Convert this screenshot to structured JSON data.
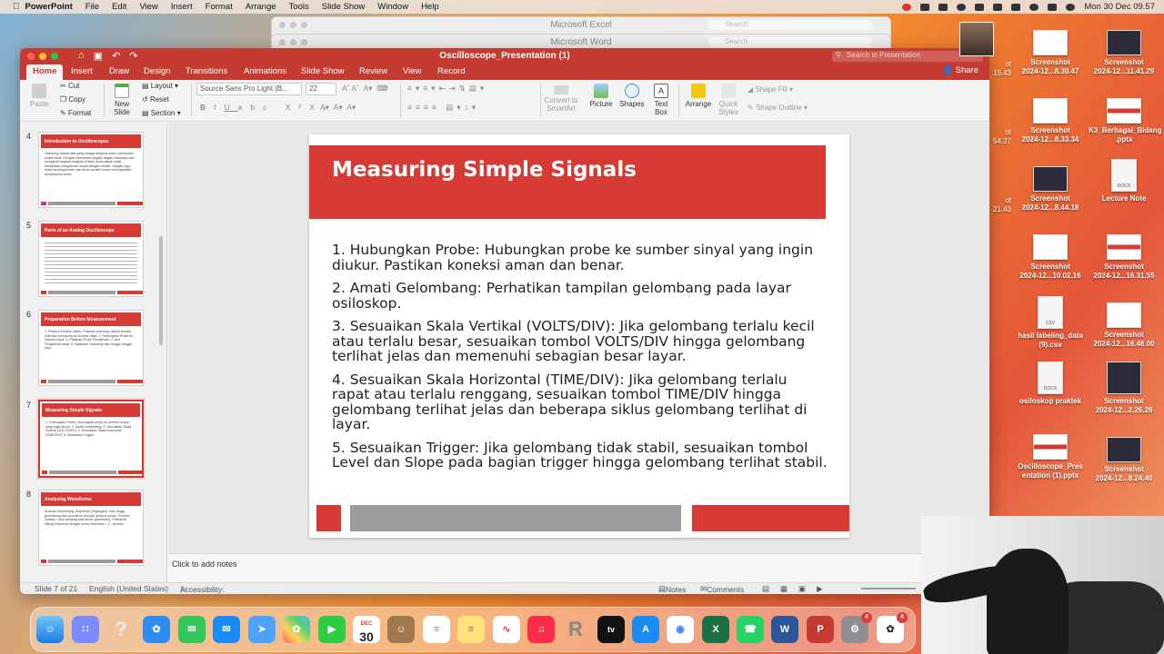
{
  "menubar": {
    "app": "PowerPoint",
    "items": [
      "File",
      "Edit",
      "View",
      "Insert",
      "Format",
      "Arrange",
      "Tools",
      "Slide Show",
      "Window",
      "Help"
    ],
    "datetime": "Mon 30 Dec  09.57"
  },
  "bg_windows": [
    {
      "title": "Microsoft Excel",
      "search": "Search"
    },
    {
      "title": "Microsoft Word",
      "search": "Search"
    }
  ],
  "window": {
    "title": "Oscilloscope_Presentation (1)",
    "search_placeholder": "Search in Presentation",
    "share": "Share"
  },
  "ribbon_tabs": [
    "Home",
    "Insert",
    "Draw",
    "Design",
    "Transitions",
    "Animations",
    "Slide Show",
    "Review",
    "View",
    "Record"
  ],
  "ribbon": {
    "paste": "Paste",
    "cut": "Cut",
    "copy": "Copy",
    "format": "Format",
    "new_slide": "New Slide",
    "layout": "Layout",
    "reset": "Reset",
    "section": "Section",
    "font": "Source Sans Pro Light (B...",
    "size": "22",
    "convert": "Convert to SmartArt",
    "picture": "Picture",
    "shapes": "Shapes",
    "text_box": "Text Box",
    "arrange": "Arrange",
    "quick_styles": "Quick Styles",
    "shape_fill": "Shape Fill",
    "shape_outline": "Shape Outline"
  },
  "thumbs": [
    {
      "num": "4",
      "title": "Introduction to Oscilloscopes",
      "body": "Osiloskop adalah alat yang sangat berguna untuk memahami sinyal listrik. Dengan memahami bagian-bagian osiloskop dan mengikuti langkah-langkah di atas, Anda dapat mulai melakukan pengukuran sinyal dengan mudah. Jangan ragu untuk bereksperimen dan terus berlatih untuk meningkatkan kemampuan Anda."
    },
    {
      "num": "5",
      "title": "Parts of an Analog Oscilloscope",
      "body": ""
    },
    {
      "num": "6",
      "title": "Preparation Before Measurement",
      "body": "1. Periksa Koneksi Listrik: Pastikan osiloskop dalam kondisi mati dan terhubung ke sumber daya. 2. Hubungkan Probe ke Saluran Input. 3. Pastikan Probe Terkalibrasi. 4. Atur Pengaturan Awal. 5. Nyalakan Osiloskop dan tunggu hingga siap."
    },
    {
      "num": "7",
      "title": "Measuring Simple Signals",
      "body": "1. Hubungkan Probe: Hubungkan probe ke sumber sinyal yang ingin diukur. 2. Amati Gelombang. 3. Sesuaikan Skala Vertikal (VOLTS/DIV). 4. Sesuaikan Skala Horizontal (TIME/DIV). 5. Sesuaikan Trigger."
    },
    {
      "num": "8",
      "title": "Analyzing Waveforms",
      "body": "Analisis Gelombang. Amplitudo (Tegangan): Ukur tinggi gelombang dari puncak ke puncak (peak-to-peak). Periode (Waktu): Ukur panjang satu siklus gelombang. Frekuensi: Hitung frekuensi dengan rumus frekuensi = 1 / periode."
    }
  ],
  "slide": {
    "title": "Measuring Simple Signals",
    "points": [
      "1. Hubungkan Probe: Hubungkan probe ke sumber sinyal yang ingin diukur. Pastikan koneksi aman dan benar.",
      "2. Amati Gelombang: Perhatikan tampilan gelombang pada layar osiloskop.",
      "3. Sesuaikan Skala Vertikal (VOLTS/DIV): Jika gelombang terlalu kecil atau terlalu besar, sesuaikan tombol VOLTS/DIV hingga gelombang terlihat jelas dan memenuhi sebagian besar layar.",
      "4. Sesuaikan Skala Horizontal (TIME/DIV): Jika gelombang terlalu rapat atau terlalu renggang, sesuaikan tombol TIME/DIV hingga gelombang terlihat jelas dan beberapa siklus gelombang terlihat di layar.",
      "5. Sesuaikan Trigger: Jika gelombang tidak stabil, sesuaikan tombol Level dan Slope pada bagian trigger hingga gelombang terlihat stabil."
    ]
  },
  "notes_placeholder": "Click to add notes",
  "status": {
    "slide": "Slide 7 of 21",
    "lang": "English (United States)",
    "accessibility": "Accessibility: Investigate",
    "notes": "Notes",
    "comments": "Comments"
  },
  "desktop": [
    {
      "label": "Screenshot\n2024-12...8.30.47"
    },
    {
      "label": "Screenshot\n2024-12...11.41.29"
    },
    {
      "label": "Screenshot\n2024-12...8.33.34"
    },
    {
      "label": "K3_Berbagai_Bidang .pptx"
    },
    {
      "label": "Screenshot\n2024-12...8.44.18"
    },
    {
      "label": "Lecture Note"
    },
    {
      "label": "Screenshot\n2024-12...10.02.16"
    },
    {
      "label": "Screenshot\n2024-12...16.31.55"
    },
    {
      "label": "hasil labeling_data\n(9).csv"
    },
    {
      "label": "Screenshot\n2024-12...16.46.00"
    },
    {
      "label": "osiloskop praktek"
    },
    {
      "label": "Screenshot\n2024-12...2.26.26"
    },
    {
      "label": "Oscilloscope_Pres\nentation (1).pptx"
    },
    {
      "label": "Screenshot\n2024-12...8.24.40"
    }
  ],
  "desktop_partial": [
    "ot\n15.43",
    "ot\n54.27",
    "ot\n21.43"
  ],
  "dock": {
    "calendar_month": "DEC",
    "calendar_day": "30",
    "badges": [
      "4",
      "4"
    ]
  }
}
